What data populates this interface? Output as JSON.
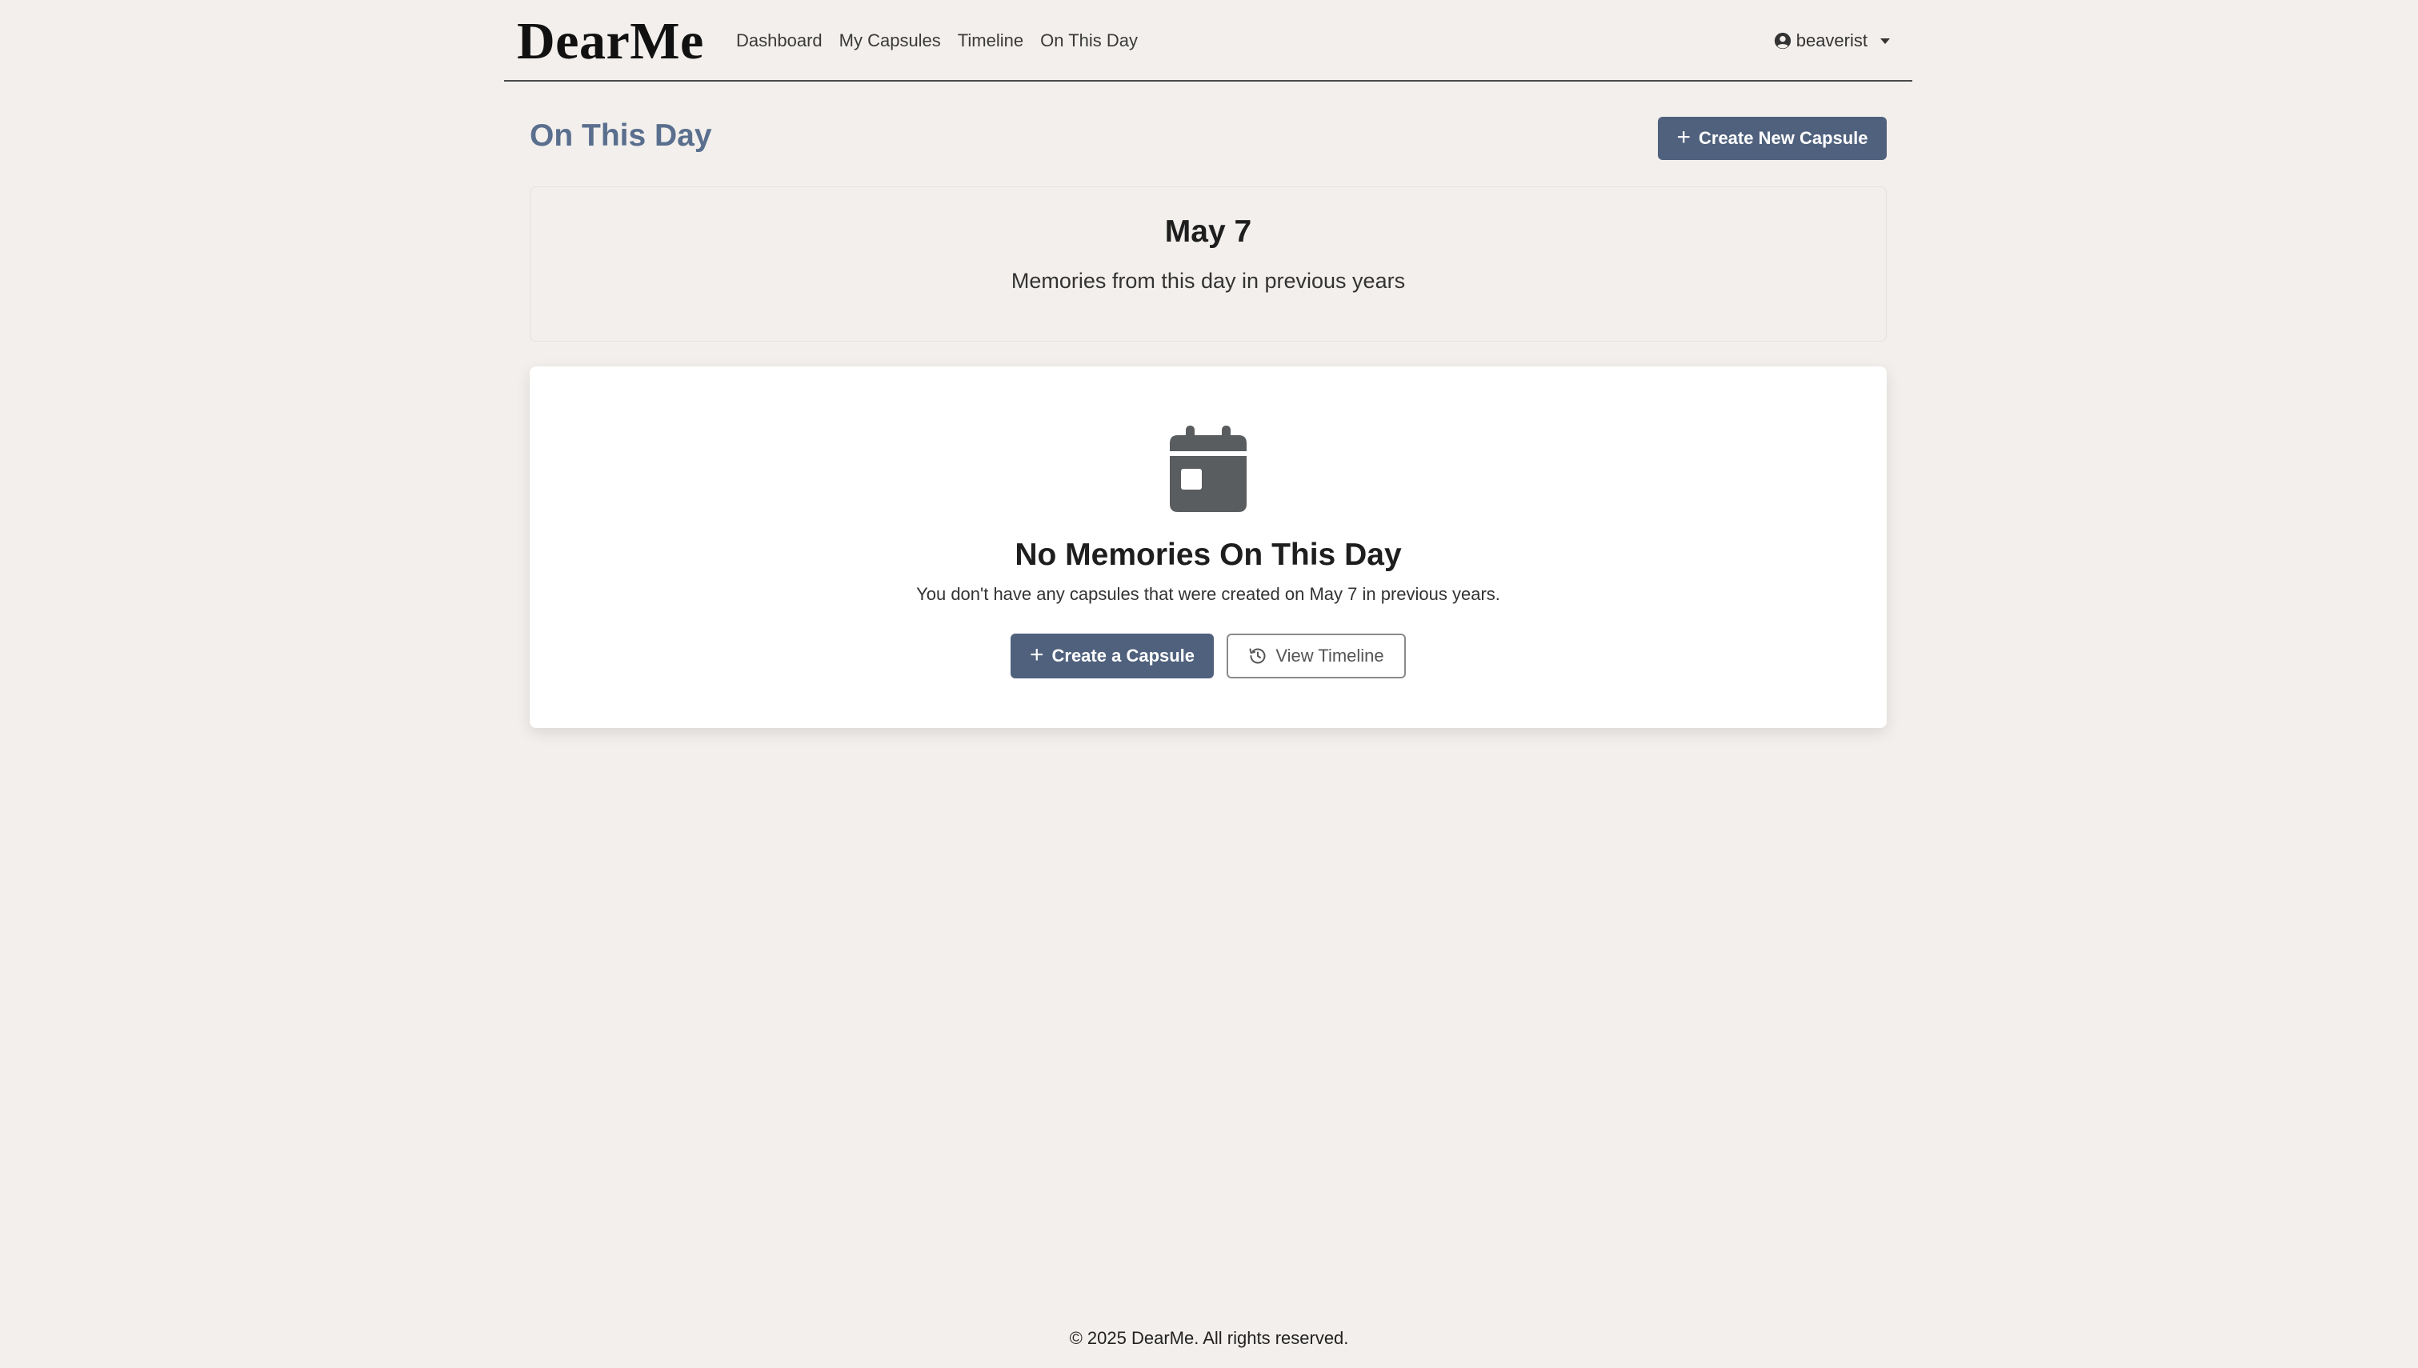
{
  "nav": {
    "brand": "DearMe",
    "links": [
      "Dashboard",
      "My Capsules",
      "Timeline",
      "On This Day"
    ],
    "user": "beaverist"
  },
  "page": {
    "title": "On This Day",
    "create_new_label": "Create New Capsule"
  },
  "date_card": {
    "date": "May 7",
    "subtitle": "Memories from this day in previous years"
  },
  "empty_state": {
    "icon": "calendar-icon",
    "title": "No Memories On This Day",
    "message": "You don't have any capsules that were created on May 7 in previous years.",
    "create_label": "Create a Capsule",
    "timeline_label": "View Timeline"
  },
  "footer": {
    "text": "© 2025 DearMe. All rights reserved."
  },
  "colors": {
    "background": "#f2efec",
    "primary": "#4f617d",
    "title_accent": "#5a6f8e"
  }
}
